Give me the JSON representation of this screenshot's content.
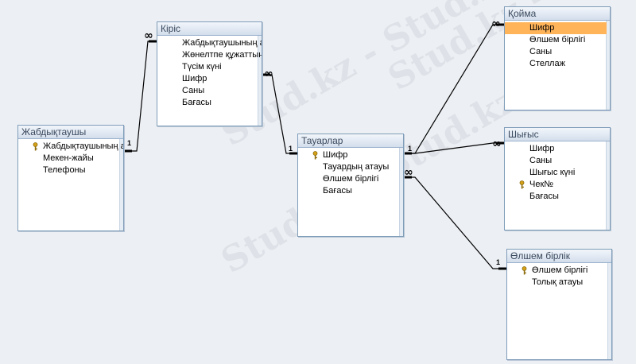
{
  "watermark": "Stud.kz - Stud.kz",
  "relationship_labels": {
    "one": "1",
    "many": "∞"
  },
  "tables": {
    "zhabdyktaushy": {
      "title": "Жабдықтаушы",
      "fields": [
        {
          "name": "Жабдықтаушының атауы",
          "key": true
        },
        {
          "name": "Мекен-жайы",
          "key": false
        },
        {
          "name": "Телефоны",
          "key": false
        }
      ]
    },
    "kiris": {
      "title": "Кіріс",
      "fields": [
        {
          "name": "Жабдықтаушының атауы",
          "key": false
        },
        {
          "name": "Жөнелтпе құжаттың №",
          "key": false
        },
        {
          "name": "Түсім күні",
          "key": false
        },
        {
          "name": "Шифр",
          "key": false
        },
        {
          "name": "Саны",
          "key": false
        },
        {
          "name": "Бағасы",
          "key": false
        }
      ]
    },
    "tauarlar": {
      "title": "Тауарлар",
      "fields": [
        {
          "name": "Шифр",
          "key": true
        },
        {
          "name": "Тауардың атауы",
          "key": false
        },
        {
          "name": "Өлшем бірлігі",
          "key": false
        },
        {
          "name": "Бағасы",
          "key": false
        }
      ]
    },
    "koima": {
      "title": "Қойма",
      "fields": [
        {
          "name": "Шифр",
          "key": false,
          "selected": true
        },
        {
          "name": "Өлшем бірлігі",
          "key": false
        },
        {
          "name": "Саны",
          "key": false
        },
        {
          "name": "Стеллаж",
          "key": false
        }
      ]
    },
    "shygys": {
      "title": "Шығыс",
      "fields": [
        {
          "name": "Шифр",
          "key": false
        },
        {
          "name": "Саны",
          "key": false
        },
        {
          "name": "Шығыс күні",
          "key": false
        },
        {
          "name": "Чек№",
          "key": true
        },
        {
          "name": "Бағасы",
          "key": false
        }
      ]
    },
    "olshem": {
      "title": "Өлшем бірлік",
      "fields": [
        {
          "name": "Өлшем бірлігі",
          "key": true
        },
        {
          "name": "Толық атауы",
          "key": false
        }
      ]
    }
  },
  "colors": {
    "background": "#ECEFF3",
    "title_bar": "#D3DEEC",
    "border": "#7F9DB9",
    "selection": "#FFB45A",
    "key_icon": "#D4A017"
  }
}
